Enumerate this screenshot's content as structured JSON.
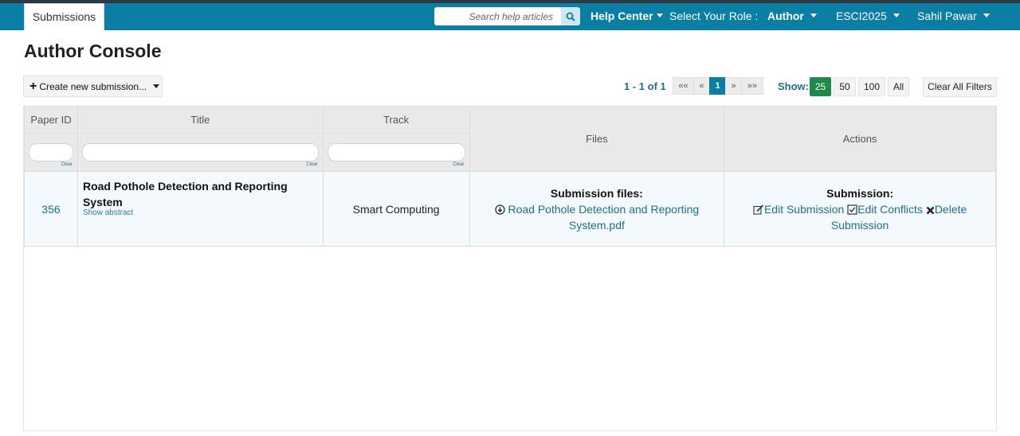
{
  "nav": {
    "tab_label": "Submissions",
    "search_placeholder": "Search help articles",
    "help_center": "Help Center",
    "role_label": "Select Your Role :",
    "role_value": "Author",
    "conference": "ESCI2025",
    "user": "Sahil Pawar",
    "brand_color": "#0b7ea3"
  },
  "page": {
    "title": "Author Console"
  },
  "toolbar": {
    "create_label": "Create new submission...",
    "range_text": "1 - 1 of 1",
    "pager": {
      "first": "««",
      "prev": "«",
      "current": "1",
      "next": "»",
      "last": "»»"
    },
    "show_label": "Show:",
    "show_options": [
      "25",
      "50",
      "100",
      "All"
    ],
    "show_selected": "25",
    "clear_filters": "Clear All Filters"
  },
  "table": {
    "headers": {
      "paper_id": "Paper ID",
      "title": "Title",
      "track": "Track",
      "files": "Files",
      "actions": "Actions"
    },
    "clear_label": "Clear",
    "rows": [
      {
        "paper_id": "356",
        "title": "Road Pothole Detection and Reporting System",
        "show_abstract": "Show abstract",
        "track": "Smart Computing",
        "files_heading": "Submission files:",
        "file_name": "Road Pothole Detection and Reporting System.pdf",
        "actions_heading": "Submission:",
        "edit_submission": "Edit Submission",
        "edit_conflicts": "Edit Conflicts",
        "delete_submission": "Delete Submission"
      }
    ]
  }
}
